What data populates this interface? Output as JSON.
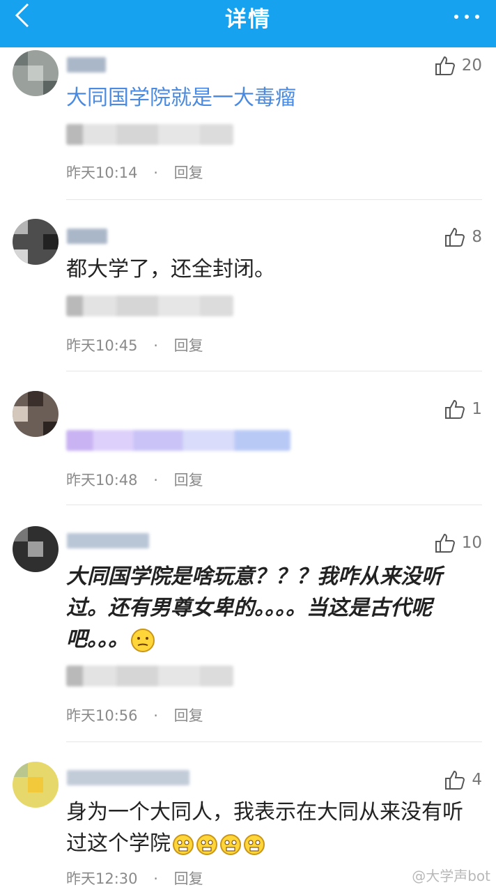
{
  "header": {
    "title": "详情"
  },
  "comments": [
    {
      "likes": "20",
      "text": "大同国学院就是一大毒瘤",
      "time": "昨天10:14",
      "reply": "回复"
    },
    {
      "likes": "8",
      "text": "都大学了，还全封闭。",
      "time": "昨天10:45",
      "reply": "回复"
    },
    {
      "likes": "1",
      "text": "",
      "time": "昨天10:48",
      "reply": "回复"
    },
    {
      "likes": "10",
      "text": "大同国学院是啥玩意？？？我咋从来没听过。还有男尊女卑的。。。。当这是古代呢吧。。。",
      "time": "昨天10:56",
      "reply": "回复"
    },
    {
      "likes": "4",
      "text": "身为一个大同人，我表示在大同从来没有听过这个学院",
      "time": "昨天12:30",
      "reply": "回复"
    }
  ],
  "watermark": "@大学声bot",
  "icons": {
    "back": "chevron-left-icon",
    "more": "more-icon",
    "like": "thumbs-up-icon"
  },
  "colors": {
    "topbar": "#17a2f0",
    "link_text": "#4a8ae0"
  }
}
